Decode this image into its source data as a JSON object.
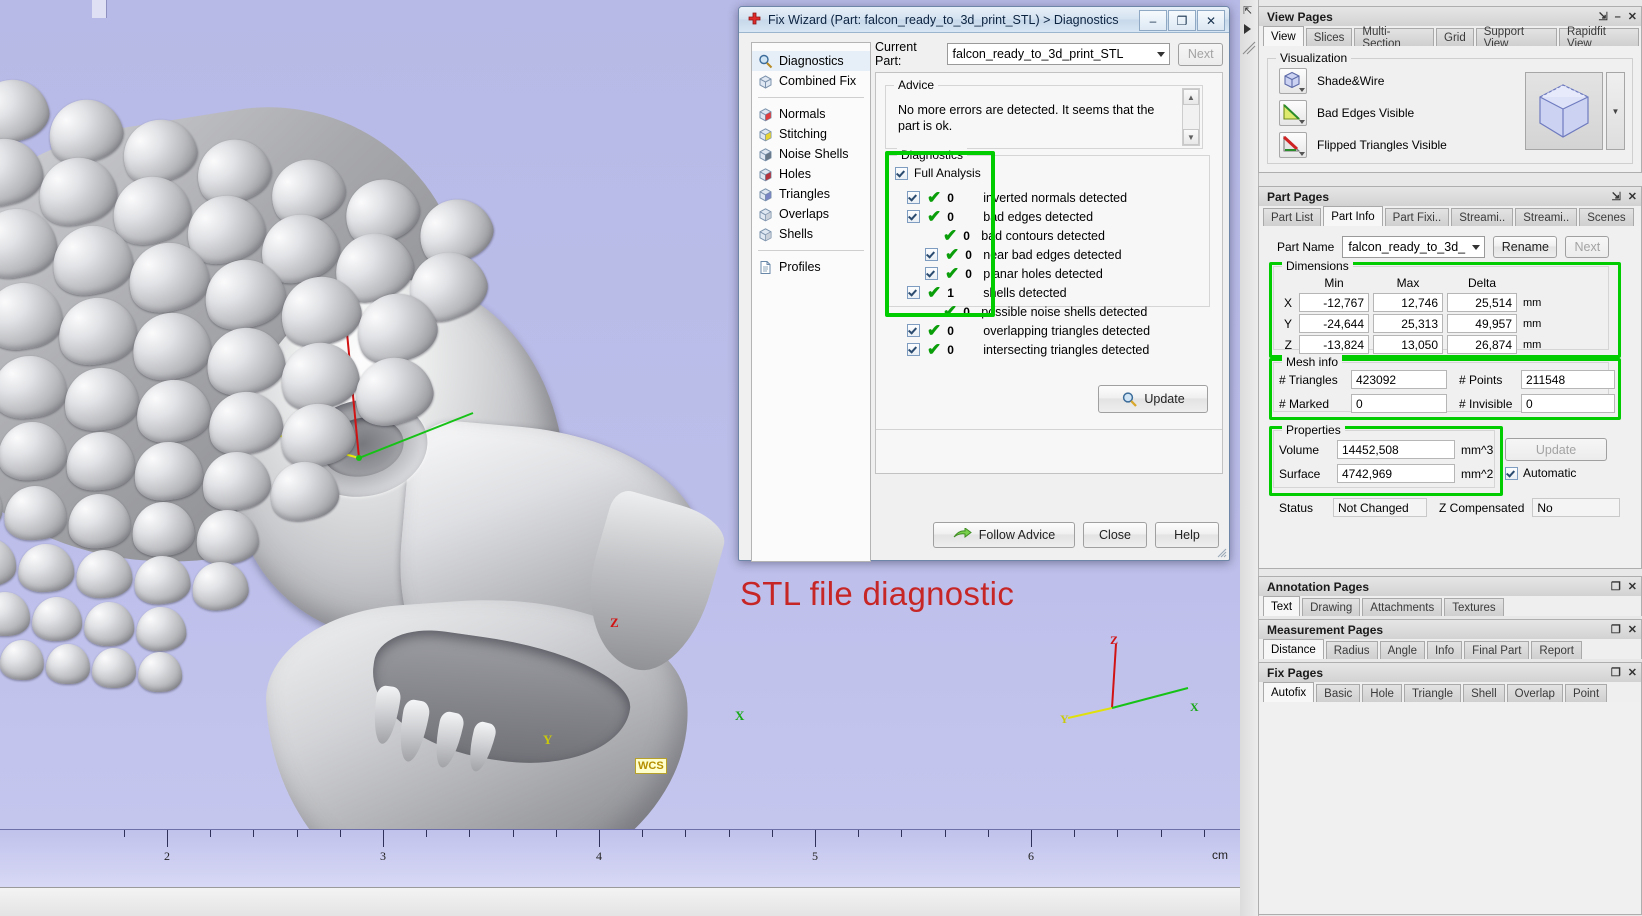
{
  "viewport": {
    "caption": "STL file diagnostic",
    "wcs_label": "WCS",
    "axes": {
      "x": "X",
      "y": "Y",
      "z": "Z"
    },
    "triad": {
      "x": "X",
      "y": "Y",
      "z": "Z"
    },
    "ruler": {
      "unit": "cm",
      "labels": [
        "2",
        "3",
        "4",
        "5",
        "6"
      ]
    }
  },
  "wizard": {
    "title": "Fix Wizard (Part: falcon_ready_to_3d_print_STL) > Diagnostics",
    "title_icon": "red-cross-icon",
    "window_buttons": {
      "minimize": "–",
      "maximize": "❐",
      "close": "✕"
    },
    "nav": {
      "top": [
        {
          "label": "Diagnostics",
          "icon": "magnifier-icon",
          "selected": true
        },
        {
          "label": "Combined Fix",
          "icon": "cube-icon",
          "selected": false
        }
      ],
      "middle": [
        {
          "label": "Normals",
          "icon": "cube-red-face-icon"
        },
        {
          "label": "Stitching",
          "icon": "cube-yellow-edge-icon"
        },
        {
          "label": "Noise Shells",
          "icon": "cube-speckled-icon"
        },
        {
          "label": "Holes",
          "icon": "cube-hole-icon"
        },
        {
          "label": "Triangles",
          "icon": "cube-wireframe-icon"
        },
        {
          "label": "Overlaps",
          "icon": "cube-overlap-icon"
        },
        {
          "label": "Shells",
          "icon": "cube-plain-icon"
        }
      ],
      "bottom": [
        {
          "label": "Profiles",
          "icon": "document-icon"
        }
      ]
    },
    "current_part": {
      "label": "Current Part:",
      "value": "falcon_ready_to_3d_print_STL",
      "next_button": "Next"
    },
    "advice": {
      "title": "Advice",
      "text": "No more errors are detected. It seems that the part is ok."
    },
    "diagnostics": {
      "title": "Diagnostics",
      "full_analysis_label": "Full Analysis",
      "full_analysis_checked": true,
      "highlight_color": "#00cc00",
      "rows": [
        {
          "label": "inverted normals detected",
          "count": "0",
          "checkbox": true,
          "indent": 0
        },
        {
          "label": "bad edges detected",
          "count": "0",
          "checkbox": true,
          "indent": 0
        },
        {
          "label": "bad contours detected",
          "count": "0",
          "checkbox": false,
          "indent": 1
        },
        {
          "label": "near bad edges detected",
          "count": "0",
          "checkbox": true,
          "indent": 1
        },
        {
          "label": "planar holes detected",
          "count": "0",
          "checkbox": true,
          "indent": 1
        },
        {
          "label": "shells detected",
          "count": "1",
          "checkbox": true,
          "indent": 0
        },
        {
          "label": "possible noise shells detected",
          "count": "0",
          "checkbox": false,
          "indent": 1
        },
        {
          "label": "overlapping triangles detected",
          "count": "0",
          "checkbox": true,
          "indent": 0
        },
        {
          "label": "intersecting triangles detected",
          "count": "0",
          "checkbox": true,
          "indent": 0
        }
      ]
    },
    "update_button": "Update",
    "footer": {
      "follow_advice": "Follow Advice",
      "close": "Close",
      "help": "Help"
    }
  },
  "dock": {
    "view_pages": {
      "title": "View Pages",
      "tabs": [
        "View",
        "Slices",
        "Multi-Section",
        "Grid",
        "Support View",
        "Rapidfit View"
      ],
      "active_tab": "View",
      "visualization": {
        "title": "Visualization",
        "items": [
          {
            "label": "Shade&Wire",
            "icon": "shade-wire-icon"
          },
          {
            "label": "Bad Edges Visible",
            "icon": "bad-edges-icon"
          },
          {
            "label": "Flipped Triangles Visible",
            "icon": "flipped-triangles-icon"
          }
        ]
      }
    },
    "part_pages": {
      "title": "Part Pages",
      "tabs": [
        "Part List",
        "Part Info",
        "Part Fixi..",
        "Streami..",
        "Streami..",
        "Scenes"
      ],
      "active_tab": "Part Info",
      "part_name": {
        "label": "Part Name",
        "value": "falcon_ready_to_3d_",
        "rename_button": "Rename",
        "next_button": "Next"
      },
      "dimensions": {
        "title": "Dimensions",
        "columns": [
          "Min",
          "Max",
          "Delta"
        ],
        "rows": [
          {
            "axis": "X",
            "min": "-12,767",
            "max": "12,746",
            "delta": "25,514",
            "unit": "mm"
          },
          {
            "axis": "Y",
            "min": "-24,644",
            "max": "25,313",
            "delta": "49,957",
            "unit": "mm"
          },
          {
            "axis": "Z",
            "min": "-13,824",
            "max": "13,050",
            "delta": "26,874",
            "unit": "mm"
          }
        ]
      },
      "mesh_info": {
        "title": "Mesh info",
        "triangles_label": "# Triangles",
        "triangles_value": "423092",
        "points_label": "# Points",
        "points_value": "211548",
        "marked_label": "# Marked",
        "marked_value": "0",
        "invisible_label": "# Invisible",
        "invisible_value": "0"
      },
      "properties": {
        "title": "Properties",
        "volume_label": "Volume",
        "volume_value": "14452,508",
        "volume_unit": "mm^3",
        "surface_label": "Surface",
        "surface_value": "4742,969",
        "surface_unit": "mm^2",
        "update_button": "Update",
        "automatic_label": "Automatic",
        "automatic_checked": true
      },
      "status": {
        "label": "Status",
        "value": "Not Changed",
        "z_label": "Z Compensated",
        "z_value": "No"
      }
    },
    "annotation_pages": {
      "title": "Annotation Pages",
      "tabs": [
        "Text",
        "Drawing",
        "Attachments",
        "Textures"
      ],
      "active_tab": "Text"
    },
    "measurement_pages": {
      "title": "Measurement Pages",
      "tabs": [
        "Distance",
        "Radius",
        "Angle",
        "Info",
        "Final Part",
        "Report"
      ],
      "active_tab": "Distance"
    },
    "fix_pages": {
      "title": "Fix Pages",
      "tabs": [
        "Autofix",
        "Basic",
        "Hole",
        "Triangle",
        "Shell",
        "Overlap",
        "Point"
      ],
      "active_tab": "Autofix"
    }
  }
}
